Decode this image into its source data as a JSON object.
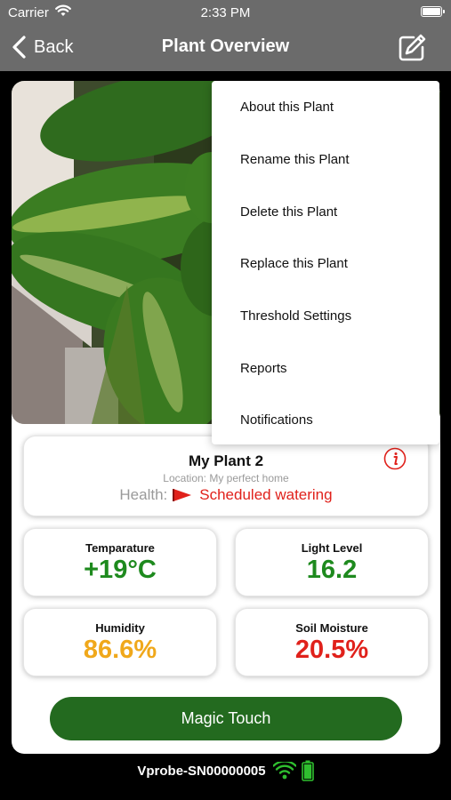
{
  "status_bar": {
    "carrier": "Carrier",
    "time": "2:33 PM"
  },
  "nav": {
    "back_label": "Back",
    "title": "Plant Overview"
  },
  "plant": {
    "name": "My Plant 2",
    "location": "Location: My perfect home",
    "health_label": "Health:",
    "health_value": "Scheduled watering"
  },
  "metrics": [
    {
      "label": "Temparature",
      "value": "+19°C",
      "color": "#1e8a1e"
    },
    {
      "label": "Light Level",
      "value": "16.2",
      "color": "#1e8a1e"
    },
    {
      "label": "Humidity",
      "value": "86.6%",
      "color": "#f0a81b"
    },
    {
      "label": "Soil Moisture",
      "value": "20.5%",
      "color": "#e0211b"
    }
  ],
  "magic_button": "Magic Touch",
  "device": {
    "name": "Vprobe-SN00000005"
  },
  "menu": {
    "items": [
      "About this Plant",
      "Rename this Plant",
      "Delete this Plant",
      "Replace this Plant",
      "Threshold Settings",
      "Reports",
      "Notifications"
    ]
  },
  "colors": {
    "nav_bg": "#6b6b6b",
    "accent_green": "#236a1f",
    "alert_red": "#e0211b"
  },
  "icons": [
    "wifi-icon",
    "battery-icon",
    "back-chevron-icon",
    "edit-icon",
    "info-icon",
    "flag-icon",
    "device-wifi-icon",
    "device-battery-icon"
  ]
}
